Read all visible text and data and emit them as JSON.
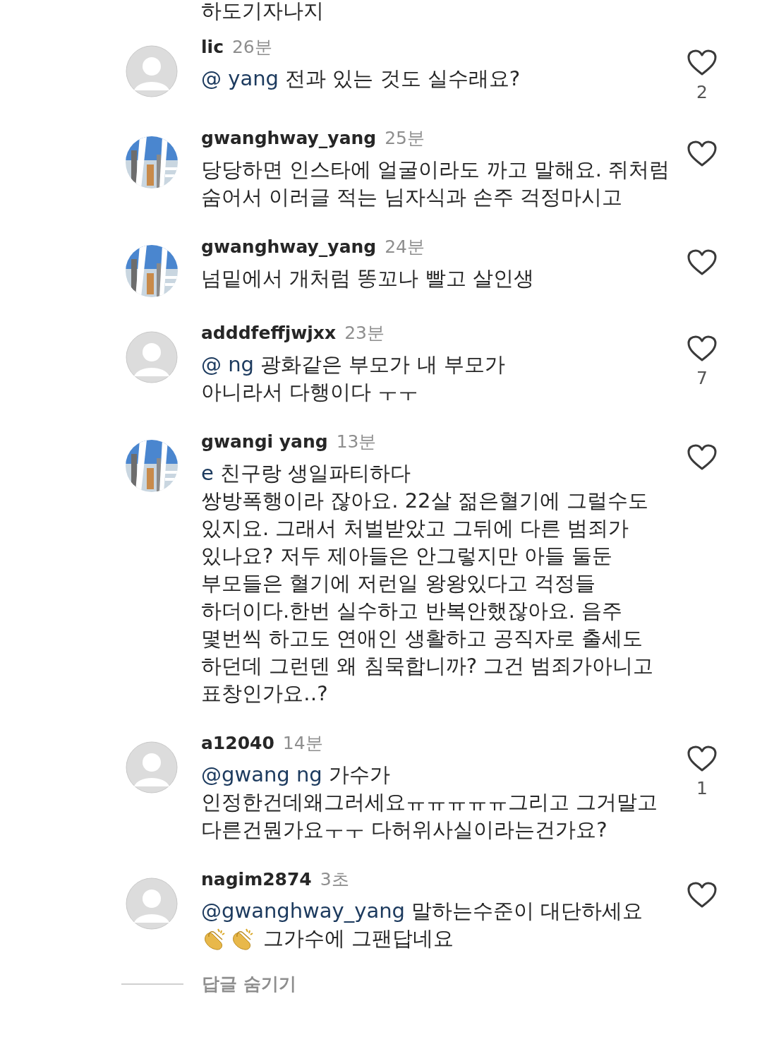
{
  "previous_comment_tail": "하도기자나지",
  "comments": [
    {
      "avatar": {
        "kind": "default"
      },
      "username": "lic",
      "time": "26분",
      "mention": "@ yang",
      "text": "전과 있는 것도 실수래요?",
      "likes": "2"
    },
    {
      "username": "gwanghway_yang",
      "time": "25분",
      "text": "당당하면 인스타에 얼굴이라도 까고 말해요. 쥐처럼\n숨어서 이러글 적는  님자식과 손주 걱정마시고"
    },
    {
      "username": "gwanghway_yang",
      "time": "24분",
      "text": "넘밑에서 개처럼 똥꼬나 빨고 살인생"
    },
    {
      "avatar": {
        "kind": "default"
      },
      "username": "adddfeffjwjxx",
      "time": "23분",
      "mention": "@ ng",
      "text": "광화같은 부모가 내 부모가\n아니라서 다행이다 ㅜㅜ",
      "likes": "7"
    },
    {
      "username": "gwangi yang",
      "time": "13분",
      "mention": "e",
      "text": "친구랑 생일파티하다\n쌍방폭행이라 잖아요. 22살 젊은혈기에 그럴수도\n있지요. 그래서 처벌받았고 그뒤에 다른 범죄가\n있나요? 저두 제아들은 안그렇지만 아들 둘둔\n부모들은 혈기에 저런일 왕왕있다고 걱정들\n하더이다.한번 실수하고 반복안했잖아요. 음주\n몇번씩 하고도 연애인 생활하고  공직자로 출세도\n하던데 그런덴 왜 침묵합니까? 그건 범죄가아니고\n표창인가요‥?"
    },
    {
      "avatar": {
        "kind": "default"
      },
      "username": "a12040",
      "time": "14분",
      "mention": "@gwang ng",
      "text": "가수가\n인정한건데왜그러세요ㅠㅠㅠㅠㅠ그리고 그거말고\n다른건뭔가요ㅜㅜ 다허위사실이라는건가요?",
      "likes": "1"
    },
    {
      "avatar": {
        "kind": "default"
      },
      "username": "nagim2874",
      "time": "3초",
      "mention": "@gwanghway_yang",
      "text": "말하는수준이 대단하세요",
      "second_line": "그가수에 그팬답네요"
    }
  ],
  "hide_replies": "답글 숨기기"
}
